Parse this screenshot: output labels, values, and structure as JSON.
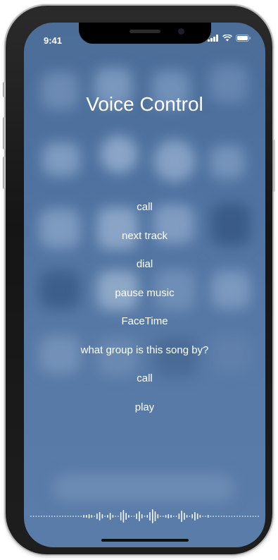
{
  "status_bar": {
    "time": "9:41",
    "icons": [
      "signal-icon",
      "wifi-icon",
      "battery-icon"
    ]
  },
  "title": "Voice Control",
  "commands": [
    "call",
    "next track",
    "dial",
    "pause music",
    "FaceTime",
    "what group is this song by?",
    "call",
    "play"
  ],
  "indicators": {
    "waveform": "listening-waveform",
    "home": "home-indicator"
  },
  "colors": {
    "background": "#5276a3",
    "text": "#ffffff",
    "device_frame": "#1c1c1c"
  }
}
